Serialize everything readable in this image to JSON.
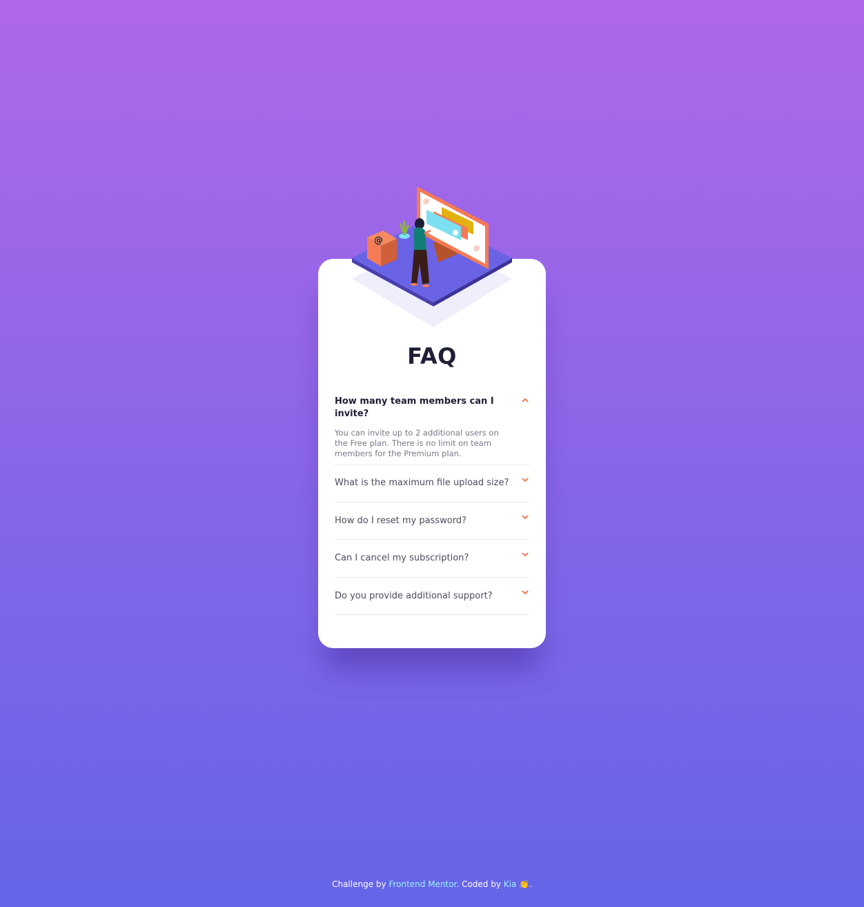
{
  "faq": {
    "title": "FAQ",
    "items": [
      {
        "question": "How many team members can I invite?",
        "answer": "You can invite up to 2 additional users on the Free plan. There is no limit on team members for the Premium plan.",
        "expanded": true
      },
      {
        "question": "What is the maximum file upload size?",
        "expanded": false
      },
      {
        "question": "How do I reset my password?",
        "expanded": false
      },
      {
        "question": "Can I cancel my subscription?",
        "expanded": false
      },
      {
        "question": "Do you provide additional support?",
        "expanded": false
      }
    ]
  },
  "footer": {
    "prefix": "Challenge by",
    "link1": "Frontend Mentor",
    "middle": ". Coded by",
    "link2": "Kia",
    "suffix": "👏."
  },
  "colors": {
    "gradient_top": "#AF67E9",
    "gradient_bottom": "#6565E7",
    "accent": "#F47B56",
    "heading": "#1E1F36"
  },
  "icons": [
    "chevron-up-icon",
    "chevron-down-icon",
    "clapping-hands-icon"
  ]
}
